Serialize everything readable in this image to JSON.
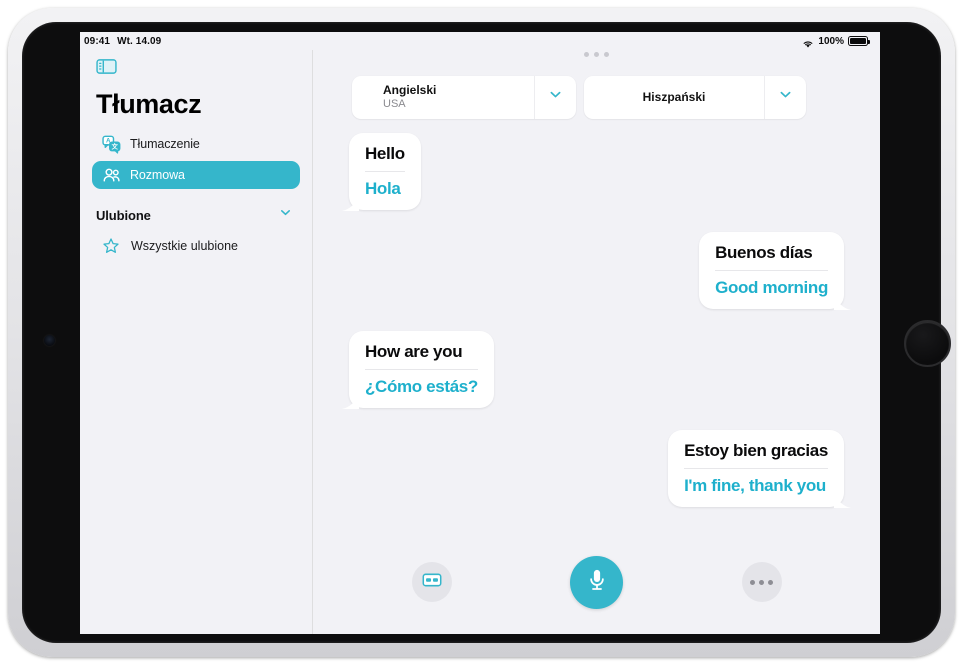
{
  "status_bar": {
    "time": "09:41",
    "date": "Wt. 14.09",
    "battery_percent": "100%",
    "wifi_icon": "wifi-icon",
    "battery_icon": "battery-full-icon"
  },
  "sidebar": {
    "toggle_icon": "sidebar-toggle-icon",
    "app_title": "Tłumacz",
    "items": [
      {
        "label": "Tłumaczenie",
        "icon": "translate-bubbles-icon",
        "active": false
      },
      {
        "label": "Rozmowa",
        "icon": "two-people-icon",
        "active": true
      }
    ],
    "section": {
      "title": "Ulubione",
      "chevron_icon": "chevron-down-icon",
      "items": [
        {
          "label": "Wszystkie ulubione",
          "icon": "star-outline-icon"
        }
      ]
    }
  },
  "main": {
    "grabber_icon": "multitasking-grabber-icon",
    "language_bar": {
      "source": {
        "name": "Angielski",
        "region": "USA",
        "chevron_icon": "chevron-down-icon"
      },
      "target": {
        "name": "Hiszpański",
        "region": "",
        "chevron_icon": "chevron-down-icon"
      }
    },
    "messages": [
      {
        "side": "left",
        "source": "Hello",
        "translation": "Hola"
      },
      {
        "side": "right",
        "source": "Buenos días",
        "translation": "Good morning"
      },
      {
        "side": "left",
        "source": "How are you",
        "translation": "¿Cómo estás?"
      },
      {
        "side": "right",
        "source": "Estoy bien gracias",
        "translation": "I'm fine, thank you"
      }
    ],
    "toolbar": {
      "flashcard_label": "flashcard-view-button",
      "flashcard_icon": "card-view-icon",
      "mic_label": "microphone-button",
      "mic_icon": "microphone-icon",
      "more_label": "more-options-button",
      "more_icon": "ellipsis-icon"
    }
  },
  "colors": {
    "accent_teal": "#35b6cb",
    "translation_text": "#1eb0cc",
    "screen_bg": "#f2f2f6",
    "bubble_bg": "#ffffff"
  }
}
